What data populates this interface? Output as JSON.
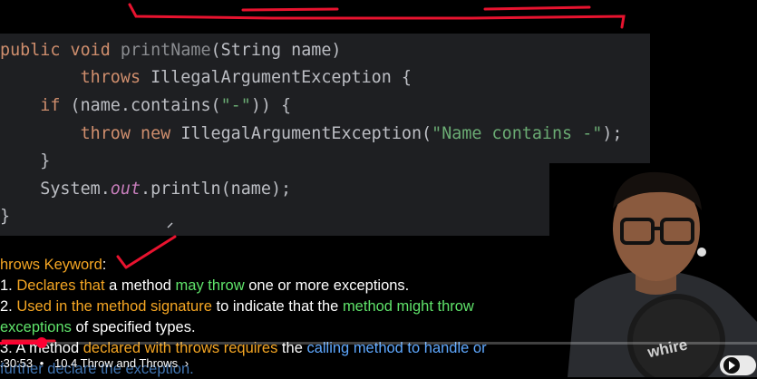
{
  "code": {
    "line1": [
      [
        "kw",
        "public "
      ],
      [
        "kw",
        "void "
      ],
      [
        "dim",
        "printName"
      ],
      [
        "plain",
        "(String name)"
      ]
    ],
    "line2": [
      [
        "plain",
        "        "
      ],
      [
        "kw",
        "throws "
      ],
      [
        "plain",
        "IllegalArgumentException {"
      ]
    ],
    "line3": [
      [
        "plain",
        "    "
      ],
      [
        "kw",
        "if "
      ],
      [
        "plain",
        "(name.contains("
      ],
      [
        "str",
        "\"-\""
      ],
      [
        "plain",
        ")) {"
      ]
    ],
    "line4": [
      [
        "plain",
        "        "
      ],
      [
        "kw",
        "throw "
      ],
      [
        "kw",
        "new "
      ],
      [
        "plain",
        "IllegalArgumentException("
      ],
      [
        "str",
        "\"Name contains -\""
      ],
      [
        "plain",
        ");"
      ]
    ],
    "line5": [
      [
        "plain",
        "    }"
      ]
    ],
    "line6": [
      [
        "plain",
        "    System."
      ],
      [
        "fld",
        "out"
      ],
      [
        "plain",
        ".println(name);"
      ]
    ],
    "line7": [
      [
        "plain",
        "}"
      ]
    ]
  },
  "notes": {
    "heading_a": "hrows Keyword",
    "heading_b": ":",
    "n1": [
      [
        "plain",
        "1. "
      ],
      [
        "orange",
        "Declares that"
      ],
      [
        "plain",
        " a method "
      ],
      [
        "green",
        "may throw"
      ],
      [
        "plain",
        " one or more exceptions."
      ]
    ],
    "n2": [
      [
        "plain",
        "2. "
      ],
      [
        "orange",
        "Used in the method signature"
      ],
      [
        "plain",
        " to indicate that the "
      ],
      [
        "green",
        "method might throw"
      ]
    ],
    "n2b": [
      [
        "plain",
        "    "
      ],
      [
        "green",
        "exceptions"
      ],
      [
        "plain",
        " of specified types."
      ]
    ],
    "n3": [
      [
        "plain",
        "3. A method "
      ],
      [
        "orange",
        "declared with throws requires"
      ],
      [
        "plain",
        " the "
      ],
      [
        "blue",
        "calling method to handle or"
      ]
    ],
    "n3b": [
      [
        "plain",
        "    "
      ],
      [
        "blue",
        "further declare the exception."
      ]
    ]
  },
  "player": {
    "time": ":30:53",
    "separator": "•",
    "chapter": "10.4 Throw and Throws",
    "chevron": "›",
    "progress_fraction": 0.055
  },
  "colors": {
    "accent": "#ff0033",
    "annotation": "#ff1a3c"
  }
}
